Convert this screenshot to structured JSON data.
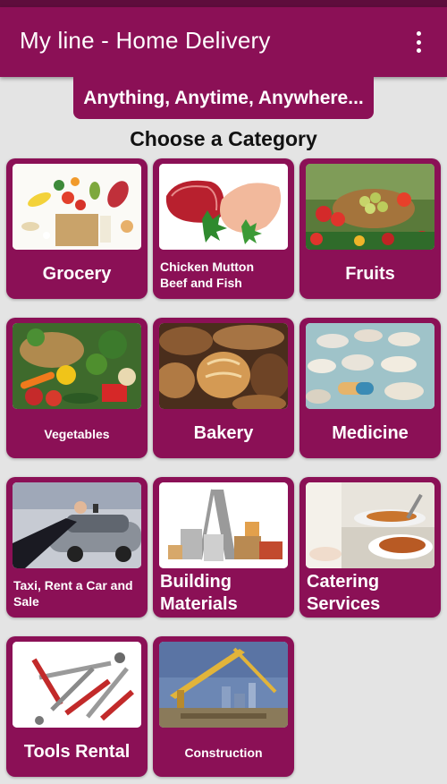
{
  "app_bar": {
    "title": "My line - Home Delivery",
    "menu_icon": "more-vert-icon",
    "color": "#8b1056"
  },
  "tagline": "Anything, Anytime, Anywhere...",
  "heading": "Choose a Category",
  "categories": [
    {
      "label": "Grocery",
      "image": "grocery-image"
    },
    {
      "label": "Chicken Mutton\nBeef and Fish",
      "image": "meat-image"
    },
    {
      "label": "Fruits",
      "image": "fruits-image"
    },
    {
      "label": "Vegetables",
      "image": "vegetables-image"
    },
    {
      "label": "Bakery",
      "image": "bakery-image"
    },
    {
      "label": "Medicine",
      "image": "medicine-image"
    },
    {
      "label": "Taxi, Rent a Car and\nSale",
      "image": "taxi-image"
    },
    {
      "label": "Building\nMaterials",
      "image": "building-materials-image"
    },
    {
      "label": "Catering\nServices",
      "image": "catering-image"
    },
    {
      "label": "Tools Rental",
      "image": "tools-image"
    },
    {
      "label": "Construction",
      "image": "construction-image"
    }
  ]
}
